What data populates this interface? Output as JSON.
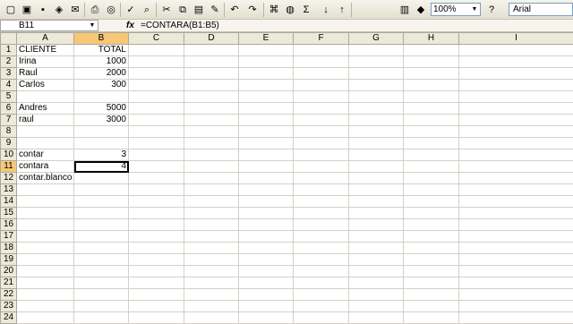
{
  "toolbar": {
    "icons": [
      "new-icon",
      "open-icon",
      "save-icon",
      "permission-icon",
      "email-icon",
      "print-icon",
      "print-preview-icon",
      "spelling-icon",
      "research-icon",
      "cut-icon",
      "copy-icon",
      "paste-icon",
      "format-painter-icon",
      "undo-icon",
      "redo-icon",
      "hyperlink-icon",
      "autosum-icon",
      "sort-asc-icon",
      "sort-desc-icon",
      "chart-icon",
      "drawing-icon",
      "help-icon"
    ],
    "zoom": "100%",
    "font": "Arial"
  },
  "formula_bar": {
    "cell_ref": "B11",
    "fx": "fx",
    "formula": "=CONTARA(B1:B5)"
  },
  "columns": [
    "A",
    "B",
    "C",
    "D",
    "E",
    "F",
    "G",
    "H",
    "I"
  ],
  "rows": [
    {
      "n": "1",
      "a": "CLIENTE",
      "b": "TOTAL"
    },
    {
      "n": "2",
      "a": "Irina",
      "b": "1000"
    },
    {
      "n": "3",
      "a": "Raul",
      "b": "2000"
    },
    {
      "n": "4",
      "a": "Carlos",
      "b": "300"
    },
    {
      "n": "5",
      "a": "",
      "b": ""
    },
    {
      "n": "6",
      "a": "Andres",
      "b": "5000"
    },
    {
      "n": "7",
      "a": "raul",
      "b": "3000"
    },
    {
      "n": "8",
      "a": "",
      "b": ""
    },
    {
      "n": "9",
      "a": "",
      "b": ""
    },
    {
      "n": "10",
      "a": "contar",
      "b": "3"
    },
    {
      "n": "11",
      "a": "contara",
      "b": "4"
    },
    {
      "n": "12",
      "a": "contar.blanco",
      "b": ""
    },
    {
      "n": "13",
      "a": "",
      "b": ""
    },
    {
      "n": "14",
      "a": "",
      "b": ""
    },
    {
      "n": "15",
      "a": "",
      "b": ""
    },
    {
      "n": "16",
      "a": "",
      "b": ""
    },
    {
      "n": "17",
      "a": "",
      "b": ""
    },
    {
      "n": "18",
      "a": "",
      "b": ""
    },
    {
      "n": "19",
      "a": "",
      "b": ""
    },
    {
      "n": "20",
      "a": "",
      "b": ""
    },
    {
      "n": "21",
      "a": "",
      "b": ""
    },
    {
      "n": "22",
      "a": "",
      "b": ""
    },
    {
      "n": "23",
      "a": "",
      "b": ""
    },
    {
      "n": "24",
      "a": "",
      "b": ""
    }
  ],
  "active_cell": {
    "col": "B",
    "row": "11"
  }
}
